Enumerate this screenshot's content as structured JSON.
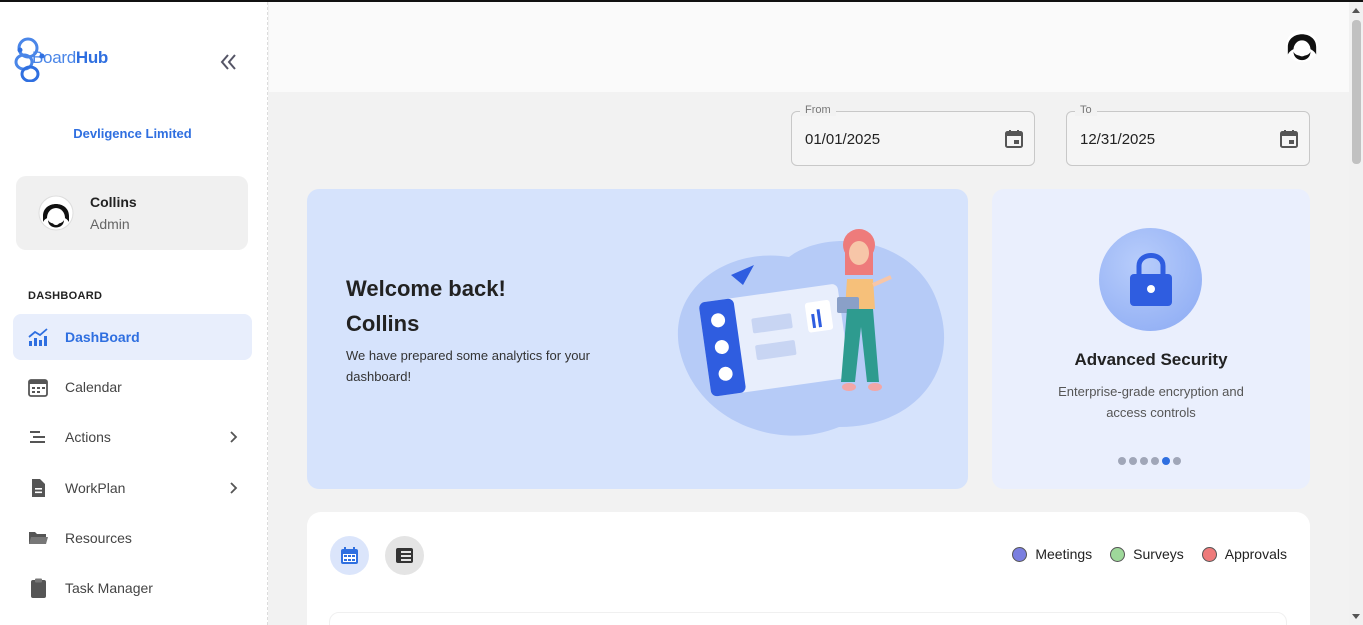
{
  "brand": {
    "name_light": "Board",
    "name_bold": "Hub",
    "accent": "#2f6fe0"
  },
  "sidebar": {
    "collapse_icon": "double-chevron-left-icon",
    "org_name": "Devligence Limited",
    "user": {
      "name": "Collins",
      "role": "Admin"
    },
    "section_label": "DASHBOARD",
    "items": [
      {
        "label": "DashBoard",
        "icon": "chart-icon",
        "active": true
      },
      {
        "label": "Calendar",
        "icon": "calendar-icon"
      },
      {
        "label": "Actions",
        "icon": "actions-icon",
        "has_submenu": true
      },
      {
        "label": "WorkPlan",
        "icon": "document-icon",
        "has_submenu": true
      },
      {
        "label": "Resources",
        "icon": "folder-icon"
      },
      {
        "label": "Task Manager",
        "icon": "clipboard-icon"
      }
    ]
  },
  "filters": {
    "from": {
      "label": "From",
      "value": "01/01/2025"
    },
    "to": {
      "label": "To",
      "value": "12/31/2025"
    }
  },
  "welcome": {
    "title_line1": "Welcome back!",
    "title_line2": "Collins",
    "subtitle": "We have prepared some analytics for your dashboard!"
  },
  "security": {
    "title": "Advanced Security",
    "description": "Enterprise-grade encryption and access controls",
    "slide_count": 6,
    "active_slide": 5
  },
  "panel": {
    "legend": [
      {
        "label": "Meetings",
        "color": "#7b7fe0"
      },
      {
        "label": "Surveys",
        "color": "#9ed89a"
      },
      {
        "label": "Approvals",
        "color": "#ee7b7b"
      }
    ]
  }
}
